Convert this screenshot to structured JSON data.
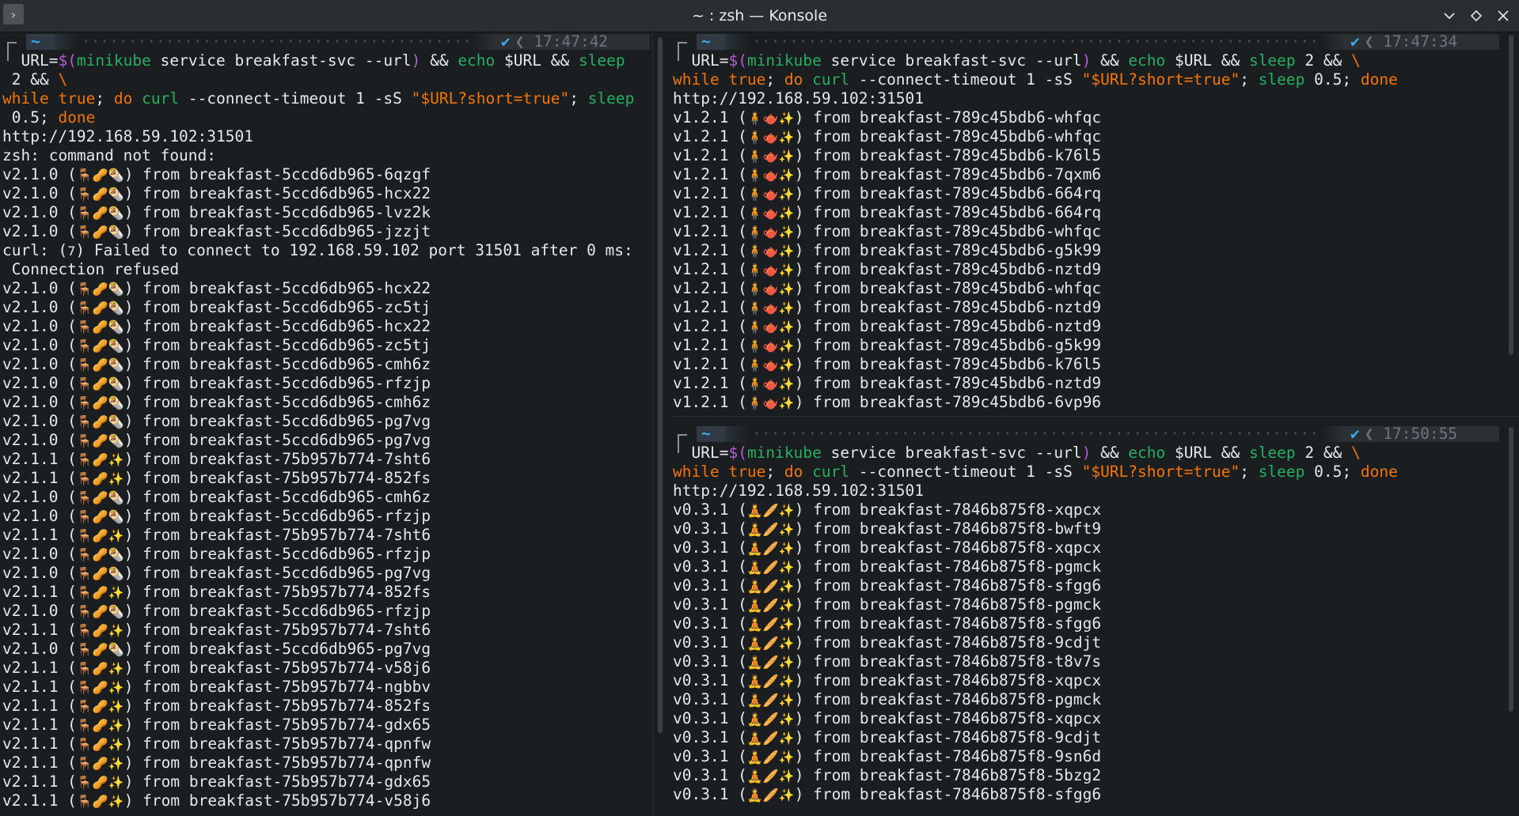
{
  "window": {
    "title": "~ : zsh — Konsole",
    "menu_icon": "chevron-right-icon",
    "controls": [
      "minimize-icon",
      "maximize-icon",
      "close-icon"
    ]
  },
  "colors": {
    "background": "#1b1e20",
    "text": "#e6e9ec",
    "keyword": "#f67400",
    "command": "#27ae60",
    "subshell": "#b65bd7",
    "prompt_home": "#3daee9"
  },
  "panes": {
    "left": {
      "prompt": {
        "dir": "~",
        "status": "✔",
        "time": "17:47:42"
      },
      "command_lines": [
        "URL=$(minikube service breakfast-svc --url) && echo $URL && sleep",
        " 2 && \\",
        "while true; do curl --connect-timeout 1 -sS \"$URL?short=true\"; sleep",
        " 0.5; done"
      ],
      "output": [
        "http://192.168.59.102:31501",
        "zsh: command not found:",
        "v2.1.0 (🪑🥜🌯) from breakfast-5ccd6db965-6qzgf",
        "v2.1.0 (🪑🥜🌯) from breakfast-5ccd6db965-hcx22",
        "v2.1.0 (🪑🥜🌯) from breakfast-5ccd6db965-lvz2k",
        "v2.1.0 (🪑🥜🌯) from breakfast-5ccd6db965-jzzjt",
        "curl: (7) Failed to connect to 192.168.59.102 port 31501 after 0 ms:",
        " Connection refused",
        "v2.1.0 (🪑🥜🌯) from breakfast-5ccd6db965-hcx22",
        "v2.1.0 (🪑🥜🌯) from breakfast-5ccd6db965-zc5tj",
        "v2.1.0 (🪑🥜🌯) from breakfast-5ccd6db965-hcx22",
        "v2.1.0 (🪑🥜🌯) from breakfast-5ccd6db965-zc5tj",
        "v2.1.0 (🪑🥜🌯) from breakfast-5ccd6db965-cmh6z",
        "v2.1.0 (🪑🥜🌯) from breakfast-5ccd6db965-rfzjp",
        "v2.1.0 (🪑🥜🌯) from breakfast-5ccd6db965-cmh6z",
        "v2.1.0 (🪑🥜🌯) from breakfast-5ccd6db965-pg7vg",
        "v2.1.0 (🪑🥜🌯) from breakfast-5ccd6db965-pg7vg",
        "v2.1.1 (🪑🥜✨) from breakfast-75b957b774-7sht6",
        "v2.1.1 (🪑🥜✨) from breakfast-75b957b774-852fs",
        "v2.1.0 (🪑🥜🌯) from breakfast-5ccd6db965-cmh6z",
        "v2.1.0 (🪑🥜🌯) from breakfast-5ccd6db965-rfzjp",
        "v2.1.1 (🪑🥜✨) from breakfast-75b957b774-7sht6",
        "v2.1.0 (🪑🥜🌯) from breakfast-5ccd6db965-rfzjp",
        "v2.1.0 (🪑🥜🌯) from breakfast-5ccd6db965-pg7vg",
        "v2.1.1 (🪑🥜✨) from breakfast-75b957b774-852fs",
        "v2.1.0 (🪑🥜🌯) from breakfast-5ccd6db965-rfzjp",
        "v2.1.1 (🪑🥜✨) from breakfast-75b957b774-7sht6",
        "v2.1.0 (🪑🥜🌯) from breakfast-5ccd6db965-pg7vg",
        "v2.1.1 (🪑🥜✨) from breakfast-75b957b774-v58j6",
        "v2.1.1 (🪑🥜✨) from breakfast-75b957b774-ngbbv",
        "v2.1.1 (🪑🥜✨) from breakfast-75b957b774-852fs",
        "v2.1.1 (🪑🥜✨) from breakfast-75b957b774-gdx65",
        "v2.1.1 (🪑🥜✨) from breakfast-75b957b774-qpnfw",
        "v2.1.1 (🪑🥜✨) from breakfast-75b957b774-qpnfw",
        "v2.1.1 (🪑🥜✨) from breakfast-75b957b774-gdx65",
        "v2.1.1 (🪑🥜✨) from breakfast-75b957b774-v58j6"
      ]
    },
    "right_top": {
      "prompt": {
        "dir": "~",
        "status": "✔",
        "time": "17:47:34"
      },
      "command_lines": [
        "URL=$(minikube service breakfast-svc --url) && echo $URL && sleep 2 && \\",
        "while true; do curl --connect-timeout 1 -sS \"$URL?short=true\"; sleep 0.5; done"
      ],
      "output": [
        "http://192.168.59.102:31501",
        "v1.2.1 (🧍🫖✨) from breakfast-789c45bdb6-whfqc",
        "v1.2.1 (🧍🫖✨) from breakfast-789c45bdb6-whfqc",
        "v1.2.1 (🧍🫖✨) from breakfast-789c45bdb6-k76l5",
        "v1.2.1 (🧍🫖✨) from breakfast-789c45bdb6-7qxm6",
        "v1.2.1 (🧍🫖✨) from breakfast-789c45bdb6-664rq",
        "v1.2.1 (🧍🫖✨) from breakfast-789c45bdb6-664rq",
        "v1.2.1 (🧍🫖✨) from breakfast-789c45bdb6-whfqc",
        "v1.2.1 (🧍🫖✨) from breakfast-789c45bdb6-g5k99",
        "v1.2.1 (🧍🫖✨) from breakfast-789c45bdb6-nztd9",
        "v1.2.1 (🧍🫖✨) from breakfast-789c45bdb6-whfqc",
        "v1.2.1 (🧍🫖✨) from breakfast-789c45bdb6-nztd9",
        "v1.2.1 (🧍🫖✨) from breakfast-789c45bdb6-nztd9",
        "v1.2.1 (🧍🫖✨) from breakfast-789c45bdb6-g5k99",
        "v1.2.1 (🧍🫖✨) from breakfast-789c45bdb6-k76l5",
        "v1.2.1 (🧍🫖✨) from breakfast-789c45bdb6-nztd9",
        "v1.2.1 (🧍🫖✨) from breakfast-789c45bdb6-6vp96"
      ]
    },
    "right_bottom": {
      "prompt": {
        "dir": "~",
        "status": "✔",
        "time": "17:50:55"
      },
      "command_lines": [
        "URL=$(minikube service breakfast-svc --url) && echo $URL && sleep 2 && \\",
        "while true; do curl --connect-timeout 1 -sS \"$URL?short=true\"; sleep 0.5; done"
      ],
      "output": [
        "http://192.168.59.102:31501",
        "v0.3.1 (🧘🥖✨) from breakfast-7846b875f8-xqpcx",
        "v0.3.1 (🧘🥖✨) from breakfast-7846b875f8-bwft9",
        "v0.3.1 (🧘🥖✨) from breakfast-7846b875f8-xqpcx",
        "v0.3.1 (🧘🥖✨) from breakfast-7846b875f8-pgmck",
        "v0.3.1 (🧘🥖✨) from breakfast-7846b875f8-sfgg6",
        "v0.3.1 (🧘🥖✨) from breakfast-7846b875f8-pgmck",
        "v0.3.1 (🧘🥖✨) from breakfast-7846b875f8-sfgg6",
        "v0.3.1 (🧘🥖✨) from breakfast-7846b875f8-9cdjt",
        "v0.3.1 (🧘🥖✨) from breakfast-7846b875f8-t8v7s",
        "v0.3.1 (🧘🥖✨) from breakfast-7846b875f8-xqpcx",
        "v0.3.1 (🧘🥖✨) from breakfast-7846b875f8-pgmck",
        "v0.3.1 (🧘🥖✨) from breakfast-7846b875f8-xqpcx",
        "v0.3.1 (🧘🥖✨) from breakfast-7846b875f8-9cdjt",
        "v0.3.1 (🧘🥖✨) from breakfast-7846b875f8-9sn6d",
        "v0.3.1 (🧘🥖✨) from breakfast-7846b875f8-5bzg2",
        "v0.3.1 (🧘🥖✨) from breakfast-7846b875f8-sfgg6"
      ]
    }
  }
}
